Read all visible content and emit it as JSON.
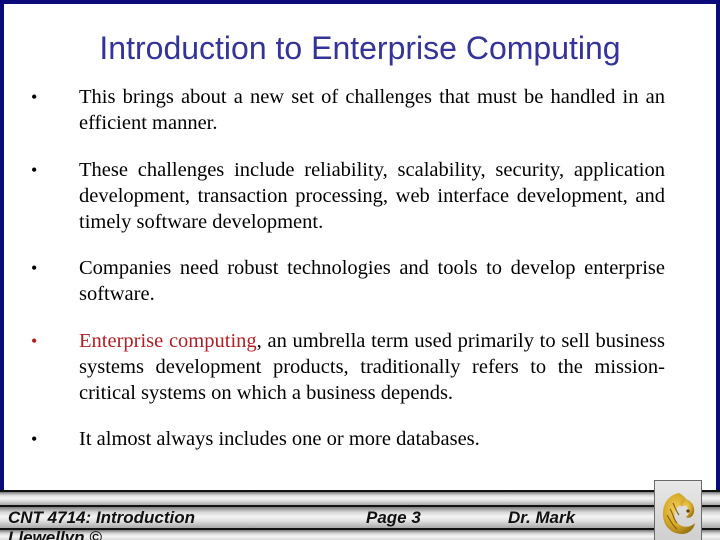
{
  "slide": {
    "title": "Introduction to Enterprise Computing",
    "bullets": [
      {
        "marker": "•",
        "text": "This brings about a new set of challenges that must be handled in an efficient manner."
      },
      {
        "marker": "•",
        "text": "These challenges include reliability, scalability, security, application development, transaction processing, web interface development, and timely software development."
      },
      {
        "marker": "•",
        "text": "Companies need robust technologies and tools to develop enterprise software."
      },
      {
        "marker": "•",
        "highlight": "Enterprise computing",
        "text": ", an umbrella term used primarily to sell business systems development products, traditionally refers to the mission-critical systems on which a business depends."
      },
      {
        "marker": "•",
        "text": "It almost always includes one or more databases."
      }
    ]
  },
  "footer": {
    "course": "CNT 4714: Introduction",
    "page": "Page 3",
    "author_line1": "Dr. Mark",
    "author_line2": "Llewellyn ©",
    "logo": "ucf-pegasus-logo"
  },
  "colors": {
    "border": "#0a0a7a",
    "title": "#33339a",
    "highlight": "#b01e23",
    "logo_gold": "#d4a82a"
  }
}
